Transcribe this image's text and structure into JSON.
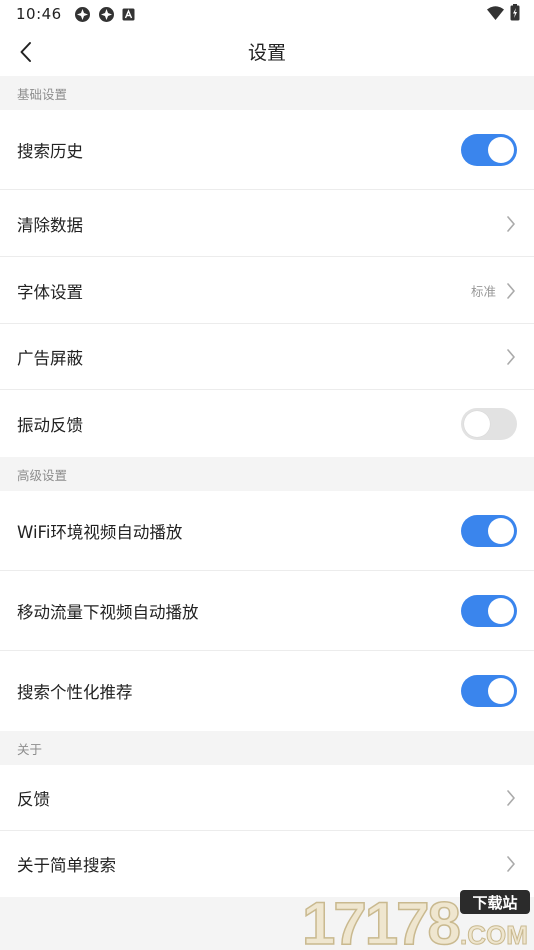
{
  "status_bar": {
    "time": "10:46"
  },
  "nav": {
    "title": "设置"
  },
  "sections": {
    "basic": {
      "title": "基础设置"
    },
    "advanced": {
      "title": "高级设置"
    },
    "about": {
      "title": "关于"
    }
  },
  "rows": {
    "search_history": {
      "label": "搜索历史",
      "toggle_on": true
    },
    "clear_data": {
      "label": "清除数据"
    },
    "font_settings": {
      "label": "字体设置",
      "value": "标准"
    },
    "ad_block": {
      "label": "广告屏蔽"
    },
    "vibration_feedback": {
      "label": "振动反馈",
      "toggle_on": false
    },
    "wifi_autoplay": {
      "label": "WiFi环境视频自动播放",
      "toggle_on": true
    },
    "mobile_autoplay": {
      "label": "移动流量下视频自动播放",
      "toggle_on": true
    },
    "personalized": {
      "label": "搜索个性化推荐",
      "toggle_on": true
    },
    "feedback": {
      "label": "反馈"
    },
    "about_app": {
      "label": "关于简单搜索"
    }
  },
  "watermark": {
    "number": "17178",
    "tag": "下载站",
    "suffix": ".COM"
  },
  "colors": {
    "accent": "#3a85ed",
    "background": "#f4f4f4",
    "toggle_off": "#e2e2e2"
  },
  "icons": [
    "back-arrow-icon",
    "chevron-right-icon",
    "wifi-icon",
    "battery-icon"
  ]
}
